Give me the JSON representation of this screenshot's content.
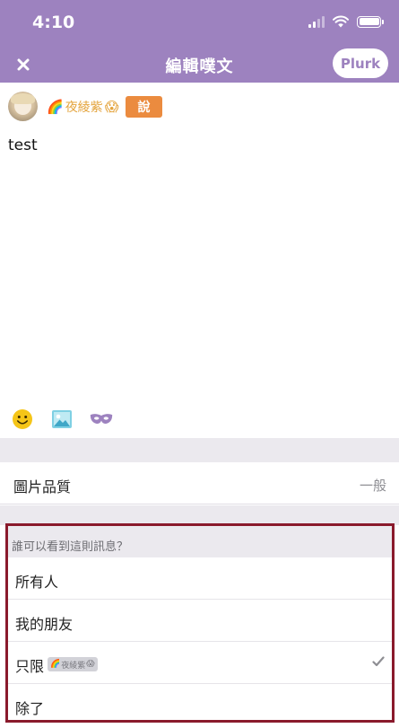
{
  "status_bar": {
    "time": "4:10"
  },
  "nav": {
    "title": "編輯噗文",
    "submit_label": "Plurk"
  },
  "compose": {
    "user_name": "夜綾紫",
    "qualifier": "說",
    "text": "test"
  },
  "settings": {
    "quality_label": "圖片品質",
    "quality_value": "一般"
  },
  "privacy": {
    "header": "誰可以看到這則訊息？",
    "options": [
      {
        "label": "所有人"
      },
      {
        "label": "我的朋友"
      },
      {
        "label": "只限",
        "badge": "夜綾紫",
        "selected": true
      },
      {
        "label": "除了"
      }
    ]
  },
  "colors": {
    "brand": "#9d82bf",
    "qualifier": "#eb8b3f",
    "username": "#e4a43d",
    "highlight_border": "#8a1a2c"
  }
}
